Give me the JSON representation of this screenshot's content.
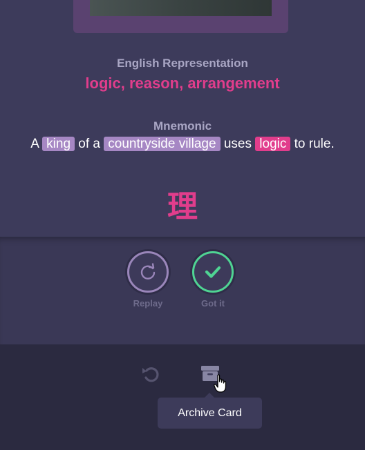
{
  "card": {
    "english_label": "English Representation",
    "english_value": "logic, reason, arrangement",
    "mnemonic_label": "Mnemonic",
    "mnemonic": {
      "p1": "A ",
      "radical1": "king",
      "p2": " of a ",
      "radical2": "countryside village",
      "p3": " uses ",
      "kanji_word": "logic",
      "p4": " to rule."
    },
    "kanji": "理"
  },
  "actions": {
    "replay_label": "Replay",
    "gotit_label": "Got it"
  },
  "footer": {
    "undo_icon": "undo-icon",
    "archive_icon": "archive-icon",
    "tooltip": "Archive Card"
  },
  "colors": {
    "background": "#3d3b5b",
    "accent_pink": "#e13d8c",
    "radical_purple": "#a687c4",
    "success_green": "#4fd493"
  }
}
